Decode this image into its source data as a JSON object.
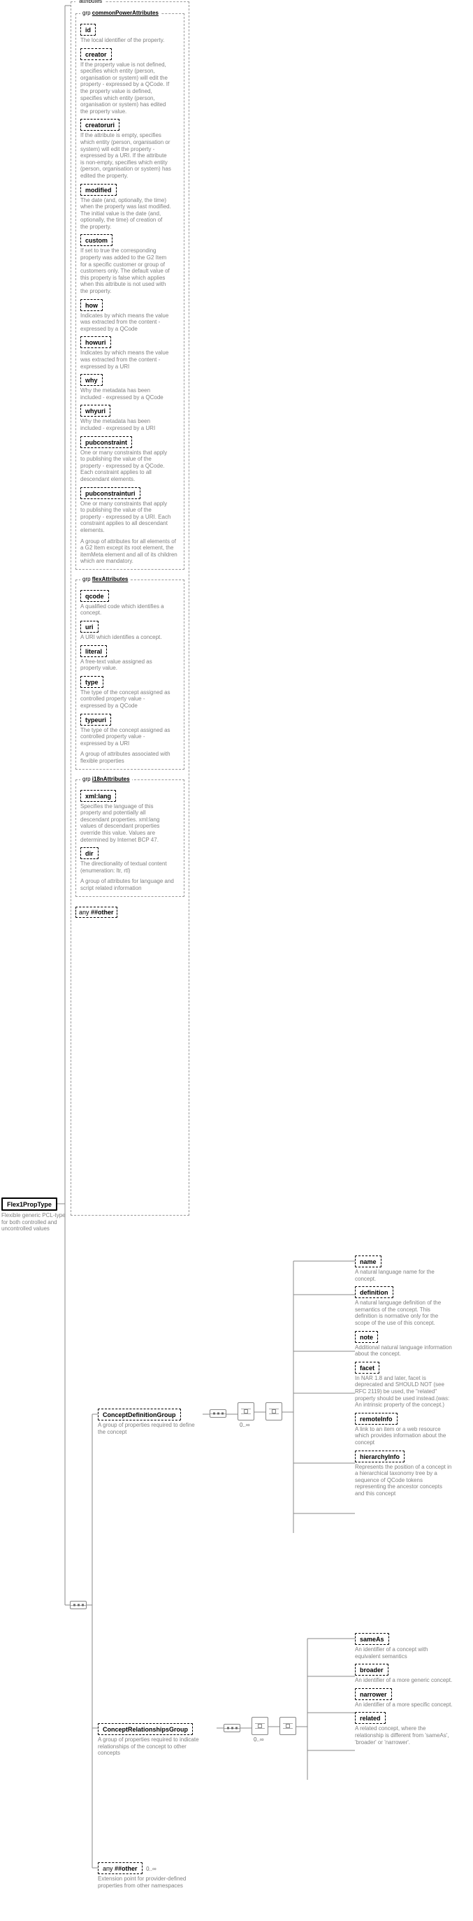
{
  "root": {
    "name": "Flex1PropType",
    "desc": "Flexible generic PCL-type for both controlled and uncontrolled values"
  },
  "attrs_label": "attributes",
  "grp_common": {
    "label_kw": "grp",
    "label_name": "commonPowerAttributes",
    "items": [
      {
        "name": "id",
        "desc": "The local identifier of the property."
      },
      {
        "name": "creator",
        "desc": "If the property value is not defined, specifies which entity (person, organisation or system) will edit the property - expressed by a QCode. If the property value is defined, specifies which entity (person, organisation or system) has edited the property value."
      },
      {
        "name": "creatoruri",
        "desc": "If the attribute is empty, specifies which entity (person, organisation or system) will edit the property - expressed by a URI. If the attribute is non-empty, specifies which entity (person, organisation or system) has edited the property."
      },
      {
        "name": "modified",
        "desc": "The date (and, optionally, the time) when the property was last modified. The initial value is the date (and, optionally, the time) of creation of the property."
      },
      {
        "name": "custom",
        "desc": "If set to true the corresponding property was added to the G2 Item for a specific customer or group of customers only. The default value of this property is false which applies when this attribute is not used with the property."
      },
      {
        "name": "how",
        "desc": "Indicates by which means the value was extracted from the content - expressed by a QCode"
      },
      {
        "name": "howuri",
        "desc": "Indicates by which means the value was extracted from the content - expressed by a URI"
      },
      {
        "name": "why",
        "desc": "Why the metadata has been included - expressed by a QCode"
      },
      {
        "name": "whyuri",
        "desc": "Why the metadata has been included - expressed by a URI"
      },
      {
        "name": "pubconstraint",
        "desc": "One or many constraints that apply to publishing the value of the property - expressed by a QCode. Each constraint applies to all descendant elements."
      },
      {
        "name": "pubconstrainturi",
        "desc": "One or many constraints that apply to publishing the value of the property - expressed by a URI. Each constraint applies to all descendant elements."
      }
    ],
    "group_desc": "A group of attributes for all elements of a G2 Item except its root element, the itemMeta element and all of its children which are mandatory."
  },
  "grp_flex": {
    "label_kw": "grp",
    "label_name": "flexAttributes",
    "items": [
      {
        "name": "qcode",
        "desc": "A qualified code which identifies a concept."
      },
      {
        "name": "uri",
        "desc": "A URI which identifies a concept."
      },
      {
        "name": "literal",
        "desc": "A free-text value assigned as property value."
      },
      {
        "name": "type",
        "desc": "The type of the concept assigned as controlled property value - expressed by a QCode"
      },
      {
        "name": "typeuri",
        "desc": "The type of the concept assigned as controlled property value - expressed by a URI"
      }
    ],
    "group_desc": "A group of attributes associated with flexible properties"
  },
  "grp_i18n": {
    "label_kw": "grp",
    "label_name": "i18nAttributes",
    "items": [
      {
        "name": "xml:lang",
        "desc": "Specifies the language of this property and potentially all descendant properties. xml:lang values of descendant properties override this value. Values are determined by Internet BCP 47."
      },
      {
        "name": "dir",
        "desc": "The directionality of textual content (enumeration: ltr, rtl)"
      }
    ],
    "group_desc": "A group of attributes for language and script related information"
  },
  "any_other": {
    "kw": "any",
    "val": "##other"
  },
  "concept_def": {
    "name": "ConceptDefinitionGroup",
    "desc": "A group of properties required to define the concept",
    "items": [
      {
        "name": "name",
        "desc": "A natural language name for the concept."
      },
      {
        "name": "definition",
        "desc": "A natural language definition of the semantics of the concept. This definition is normative only for the scope of the use of this concept."
      },
      {
        "name": "note",
        "desc": "Additional natural language information about the concept."
      },
      {
        "name": "facet",
        "desc": "In NAR 1.8 and later, facet is deprecated and SHOULD NOT (see RFC 2119) be used, the \"related\" property should be used instead.(was: An intrinsic property of the concept.)"
      },
      {
        "name": "remoteInfo",
        "desc": "A link to an item or a web resource which provides information about the concept"
      },
      {
        "name": "hierarchyInfo",
        "desc": "Represents the position of a concept in a hierarchical taxonomy tree by a sequence of QCode tokens representing the ancestor concepts and this concept"
      }
    ]
  },
  "concept_rel": {
    "name": "ConceptRelationshipsGroup",
    "desc": "A group of properties required to indicate relationships of the concept to other concepts",
    "items": [
      {
        "name": "sameAs",
        "desc": "An identifier of a concept with equivalent semantics"
      },
      {
        "name": "broader",
        "desc": "An identifier of a more generic concept."
      },
      {
        "name": "narrower",
        "desc": "An identifier of a more specific concept."
      },
      {
        "name": "related",
        "desc": "A related concept, where the relationship is different from 'sameAs', 'broader' or 'narrower'."
      }
    ]
  },
  "any_other2": {
    "kw": "any",
    "val": "##other",
    "card": "0..∞",
    "desc": "Extension point for provider-defined properties from other namespaces"
  },
  "card_inf": "0..∞"
}
